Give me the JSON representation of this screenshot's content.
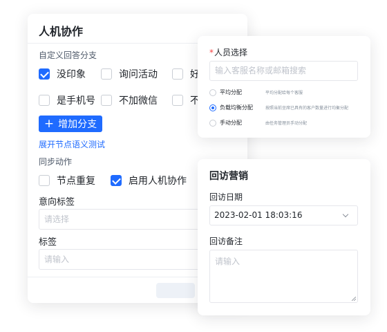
{
  "collab_card": {
    "title": "人机协作",
    "branch_section_label": "自定义回答分支",
    "branch_options": [
      {
        "label": "没印象",
        "checked": true
      },
      {
        "label": "询问活动",
        "checked": false
      },
      {
        "label": "好",
        "checked": false
      },
      {
        "label": "是手机号",
        "checked": false
      },
      {
        "label": "不加微信",
        "checked": false
      },
      {
        "label": "不",
        "checked": false
      }
    ],
    "add_branch_label": "增加分支",
    "expand_link_label": "展开节点语义测试",
    "sync_section_label": "同步动作",
    "sync_options": [
      {
        "label": "节点重复",
        "checked": false
      },
      {
        "label": "启用人机协作",
        "checked": true
      }
    ],
    "intent_tag_label": "意向标签",
    "intent_tag_placeholder": "请选择",
    "tag_label": "标签",
    "tag_placeholder": "请输入"
  },
  "staff_card": {
    "required_mark": "*",
    "label": "人员选择",
    "search_placeholder": "输入客服名称或邮箱搜索",
    "options": [
      {
        "label": "平均分配",
        "desc": "平均分配给每个客服",
        "selected": false
      },
      {
        "label": "负载均衡分配",
        "desc": "按照当前坐席已具有的客户数量进行均衡分配",
        "selected": true
      },
      {
        "label": "手动分配",
        "desc": "由任务管理员手动分配",
        "selected": false
      }
    ]
  },
  "revisit_card": {
    "title": "回访营销",
    "date_label": "回访日期",
    "date_value": "2023-02-01   18:03:16",
    "note_label": "回访备注",
    "note_placeholder": "请输入"
  },
  "colors": {
    "accent": "#1f6bff",
    "required": "#f53f3f"
  }
}
